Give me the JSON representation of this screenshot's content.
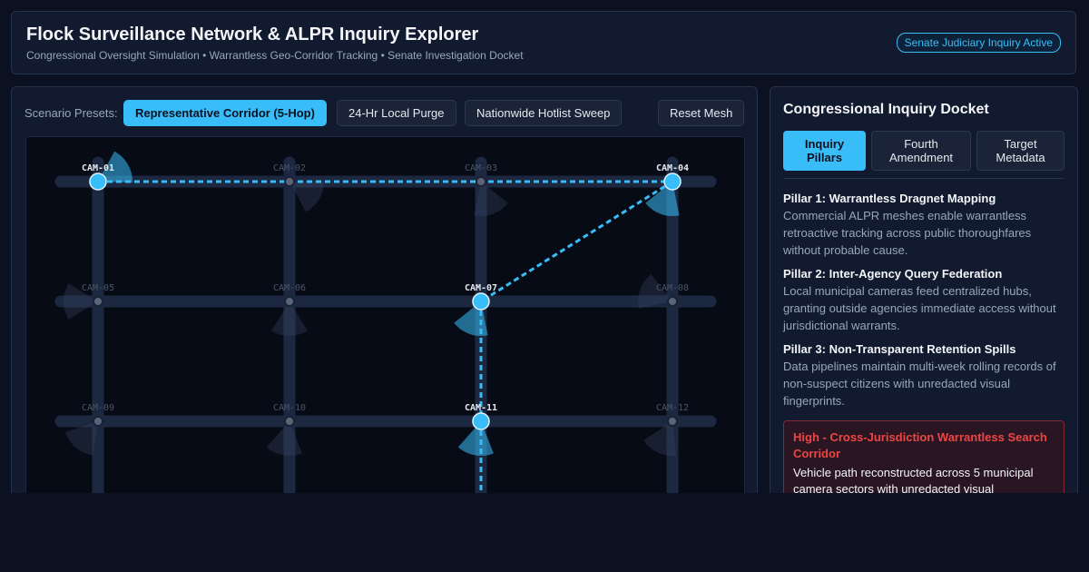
{
  "header": {
    "title": "Flock Surveillance Network & ALPR Inquiry Explorer",
    "subtitle": "Congressional Oversight Simulation • Warrantless Geo-Corridor Tracking • Senate Investigation Docket",
    "badge": "Senate Judiciary Inquiry Active"
  },
  "presets": {
    "label": "Scenario Presets:",
    "buttons": [
      {
        "label": "Representative Corridor (5-Hop)",
        "active": true
      },
      {
        "label": "24-Hr Local Purge",
        "active": false
      },
      {
        "label": "Nationwide Hotlist Sweep",
        "active": false
      }
    ],
    "reset_label": "Reset Mesh"
  },
  "map": {
    "cameras": [
      {
        "id": "CAM-01",
        "active": true
      },
      {
        "id": "CAM-02",
        "active": false
      },
      {
        "id": "CAM-03",
        "active": false
      },
      {
        "id": "CAM-04",
        "active": true
      },
      {
        "id": "CAM-05",
        "active": false
      },
      {
        "id": "CAM-06",
        "active": false
      },
      {
        "id": "CAM-07",
        "active": true
      },
      {
        "id": "CAM-08",
        "active": false
      },
      {
        "id": "CAM-09",
        "active": false
      },
      {
        "id": "CAM-10",
        "active": false
      },
      {
        "id": "CAM-11",
        "active": true
      },
      {
        "id": "CAM-12",
        "active": false
      }
    ],
    "route": [
      "CAM-01",
      "CAM-04",
      "CAM-07",
      "CAM-11"
    ],
    "colors": {
      "accent": "#38bdf8",
      "road": "#1c2740",
      "inactive_label": "#4b5569"
    }
  },
  "docket": {
    "title": "Congressional Inquiry Docket",
    "tabs": [
      {
        "label": "Inquiry Pillars",
        "active": true
      },
      {
        "label": "Fourth Amendment",
        "active": false
      },
      {
        "label": "Target Metadata",
        "active": false
      }
    ],
    "pillars": [
      {
        "title": "Pillar 1: Warrantless Dragnet Mapping",
        "body": "Commercial ALPR meshes enable warrantless retroactive tracking across public thoroughfares without probable cause."
      },
      {
        "title": "Pillar 2: Inter-Agency Query Federation",
        "body": "Local municipal cameras feed centralized hubs, granting outside agencies immediate access without jurisdictional warrants."
      },
      {
        "title": "Pillar 3: Non-Transparent Retention Spills",
        "body": "Data pipelines maintain multi-week rolling records of non-suspect citizens with unredacted visual fingerprints."
      }
    ],
    "alert": {
      "title": "High - Cross-Jurisdiction Warrantless Search Corridor",
      "body": "Vehicle path reconstructed across 5 municipal camera sectors with unredacted visual"
    }
  }
}
